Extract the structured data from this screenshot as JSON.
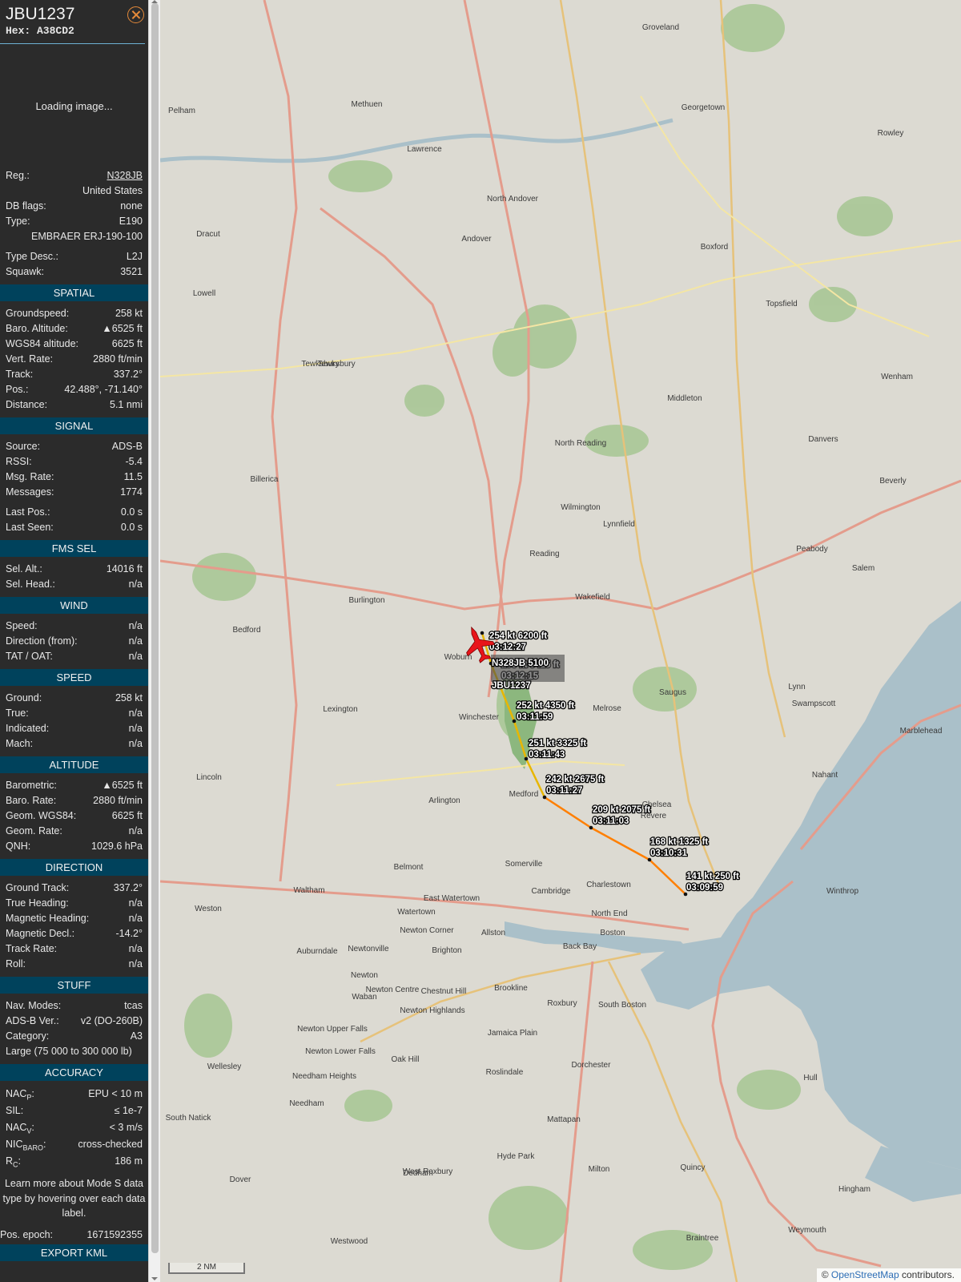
{
  "aircraft": {
    "callsign": "JBU1237",
    "hex_line": "Hex: A38CD2",
    "photo_status": "Loading image..."
  },
  "info": {
    "reg_label": "Reg.:",
    "reg_value": "N328JB",
    "country": "United States",
    "dbflags_label": "DB flags:",
    "dbflags_value": "none",
    "type_label": "Type:",
    "type_value": "E190",
    "type_full": "EMBRAER ERJ-190-100",
    "typedesc_label": "Type Desc.:",
    "typedesc_value": "L2J",
    "squawk_label": "Squawk:",
    "squawk_value": "3521"
  },
  "spatial": {
    "title": "SPATIAL",
    "rows": [
      {
        "k": "Groundspeed:",
        "v": "258 kt"
      },
      {
        "k": "Baro. Altitude:",
        "v": "▲6525 ft"
      },
      {
        "k": "WGS84 altitude:",
        "v": "6625 ft"
      },
      {
        "k": "Vert. Rate:",
        "v": "2880 ft/min"
      },
      {
        "k": "Track:",
        "v": "337.2°"
      },
      {
        "k": "Pos.:",
        "v": "42.488°, -71.140°"
      },
      {
        "k": "Distance:",
        "v": "5.1 nmi"
      }
    ]
  },
  "signal": {
    "title": "SIGNAL",
    "rows": [
      {
        "k": "Source:",
        "v": "ADS-B"
      },
      {
        "k": "RSSI:",
        "v": "-5.4"
      },
      {
        "k": "Msg. Rate:",
        "v": "11.5"
      },
      {
        "k": "Messages:",
        "v": "1774"
      }
    ],
    "rows2": [
      {
        "k": "Last Pos.:",
        "v": "0.0 s"
      },
      {
        "k": "Last Seen:",
        "v": "0.0 s"
      }
    ]
  },
  "fms": {
    "title": "FMS SEL",
    "rows": [
      {
        "k": "Sel. Alt.:",
        "v": "14016 ft"
      },
      {
        "k": "Sel. Head.:",
        "v": "n/a"
      }
    ]
  },
  "wind": {
    "title": "WIND",
    "rows": [
      {
        "k": "Speed:",
        "v": "n/a"
      },
      {
        "k": "Direction (from):",
        "v": "n/a"
      },
      {
        "k": "TAT / OAT:",
        "v": "n/a"
      }
    ]
  },
  "speed": {
    "title": "SPEED",
    "rows": [
      {
        "k": "Ground:",
        "v": "258 kt"
      },
      {
        "k": "True:",
        "v": "n/a"
      },
      {
        "k": "Indicated:",
        "v": "n/a"
      },
      {
        "k": "Mach:",
        "v": "n/a"
      }
    ]
  },
  "altitude": {
    "title": "ALTITUDE",
    "rows": [
      {
        "k": "Barometric:",
        "v": "▲6525 ft"
      },
      {
        "k": "Baro. Rate:",
        "v": "2880 ft/min"
      },
      {
        "k": "Geom. WGS84:",
        "v": "6625 ft"
      },
      {
        "k": "Geom. Rate:",
        "v": "n/a"
      },
      {
        "k": "QNH:",
        "v": "1029.6 hPa"
      }
    ]
  },
  "direction": {
    "title": "DIRECTION",
    "rows": [
      {
        "k": "Ground Track:",
        "v": "337.2°"
      },
      {
        "k": "True Heading:",
        "v": "n/a"
      },
      {
        "k": "Magnetic Heading:",
        "v": "n/a"
      },
      {
        "k": "Magnetic Decl.:",
        "v": "-14.2°"
      },
      {
        "k": "Track Rate:",
        "v": "n/a"
      },
      {
        "k": "Roll:",
        "v": "n/a"
      }
    ]
  },
  "stuff": {
    "title": "STUFF",
    "rows": [
      {
        "k": "Nav. Modes:",
        "v": "tcas"
      },
      {
        "k": "ADS-B Ver.:",
        "v": "v2 (DO-260B)"
      },
      {
        "k": "Category:",
        "v": "A3"
      }
    ],
    "category_desc": "Large (75 000 to 300 000 lb)"
  },
  "accuracy": {
    "title": "ACCURACY",
    "nacp_k": "NAC",
    "nacp_sub": "P",
    "nacp_v": "EPU < 10 m",
    "sil_k": "SIL:",
    "sil_v": "≤ 1e-7",
    "nacv_k": "NAC",
    "nacv_sub": "V",
    "nacv_v": "< 3 m/s",
    "nicbaro_k": "NIC",
    "nicbaro_sub": "BARO",
    "nicbaro_v": "cross-checked",
    "rc_k": "R",
    "rc_sub": "C",
    "rc_v": "186 m"
  },
  "footer": {
    "note": "Learn more about Mode S data type by hovering over each data label.",
    "epoch_label": "Pos. epoch:",
    "epoch_value": "1671592355",
    "export_title": "EXPORT KML"
  },
  "map": {
    "attribution_prefix": "©",
    "attribution_link": "OpenStreetMap",
    "attribution_suffix": "contributors.",
    "scale": "2 NM",
    "place_labels": [
      "Methuen",
      "Lawrence",
      "North Andover",
      "Dracut",
      "Andover",
      "Lowell",
      "Tewksbury",
      "Billerica",
      "Wilmington",
      "North Reading",
      "Middleton",
      "Boxford",
      "Georgetown",
      "Groveland",
      "Rowley",
      "Topsfield",
      "Wenham",
      "Danvers",
      "Beverly",
      "Peabody",
      "Salem",
      "Lynnfield",
      "Reading",
      "Wakefield",
      "Burlington",
      "Bedford",
      "Woburn",
      "Winchester",
      "Lexington",
      "Arlington",
      "Medford",
      "Melrose",
      "Saugus",
      "Lynn",
      "Swampscott",
      "Marblehead",
      "Revere",
      "Nahant",
      "Winthrop",
      "Somerville",
      "Cambridge",
      "Belmont",
      "Waltham",
      "Watertown",
      "Weston",
      "Newton",
      "Boston",
      "Brookline",
      "Roxbury",
      "Dorchester",
      "South Boston",
      "Wellesley",
      "Needham",
      "Dedham",
      "Milton",
      "Quincy",
      "Hull",
      "Hingham",
      "Braintree",
      "Weymouth",
      "Dover",
      "Westwood",
      "South Natick",
      "Lincoln",
      "Charlestown",
      "Chelsea",
      "Jamaica Plain",
      "Mattapan",
      "Hyde Park",
      "Roslindale",
      "West Roxbury",
      "Auburndale",
      "Newtonville",
      "Newton Centre",
      "Chestnut Hill",
      "Waban",
      "Brighton",
      "Allston",
      "North End",
      "Back Bay",
      "East Watertown",
      "Newton Corner",
      "Newton Highlands",
      "Newton Upper Falls",
      "Newton Lower Falls",
      "Needham Heights",
      "Oak Hill",
      "Pelham",
      "Tewksbury"
    ],
    "aircraft_label": "N328JB 5100",
    "aircraft_label2": "JBU1237"
  },
  "track": [
    {
      "gs": "254 kt",
      "alt": "6200 ft",
      "t": "03:12:27"
    },
    {
      "gs": "253 kt",
      "alt": "5425 ft",
      "t": "03:12:15"
    },
    {
      "gs": "252 kt",
      "alt": "4350 ft",
      "t": "03:11:59"
    },
    {
      "gs": "251 kt",
      "alt": "3325 ft",
      "t": "03:11:43"
    },
    {
      "gs": "242 kt",
      "alt": "2675 ft",
      "t": "03:11:27"
    },
    {
      "gs": "209 kt",
      "alt": "2075 ft",
      "t": "03:11:03"
    },
    {
      "gs": "168 kt",
      "alt": "1325 ft",
      "t": "03:10:31"
    },
    {
      "gs": "141 kt",
      "alt": "250 ft",
      "t": "03:09:59"
    }
  ],
  "colors": {
    "panel_bg": "#2b2b2b",
    "section_bg": "#00425c",
    "accent": "#e58a3a",
    "track_low": "#ff7f00",
    "track_high": "#e8b600",
    "aircraft": "#e8141a",
    "water": "#aac0c9"
  }
}
